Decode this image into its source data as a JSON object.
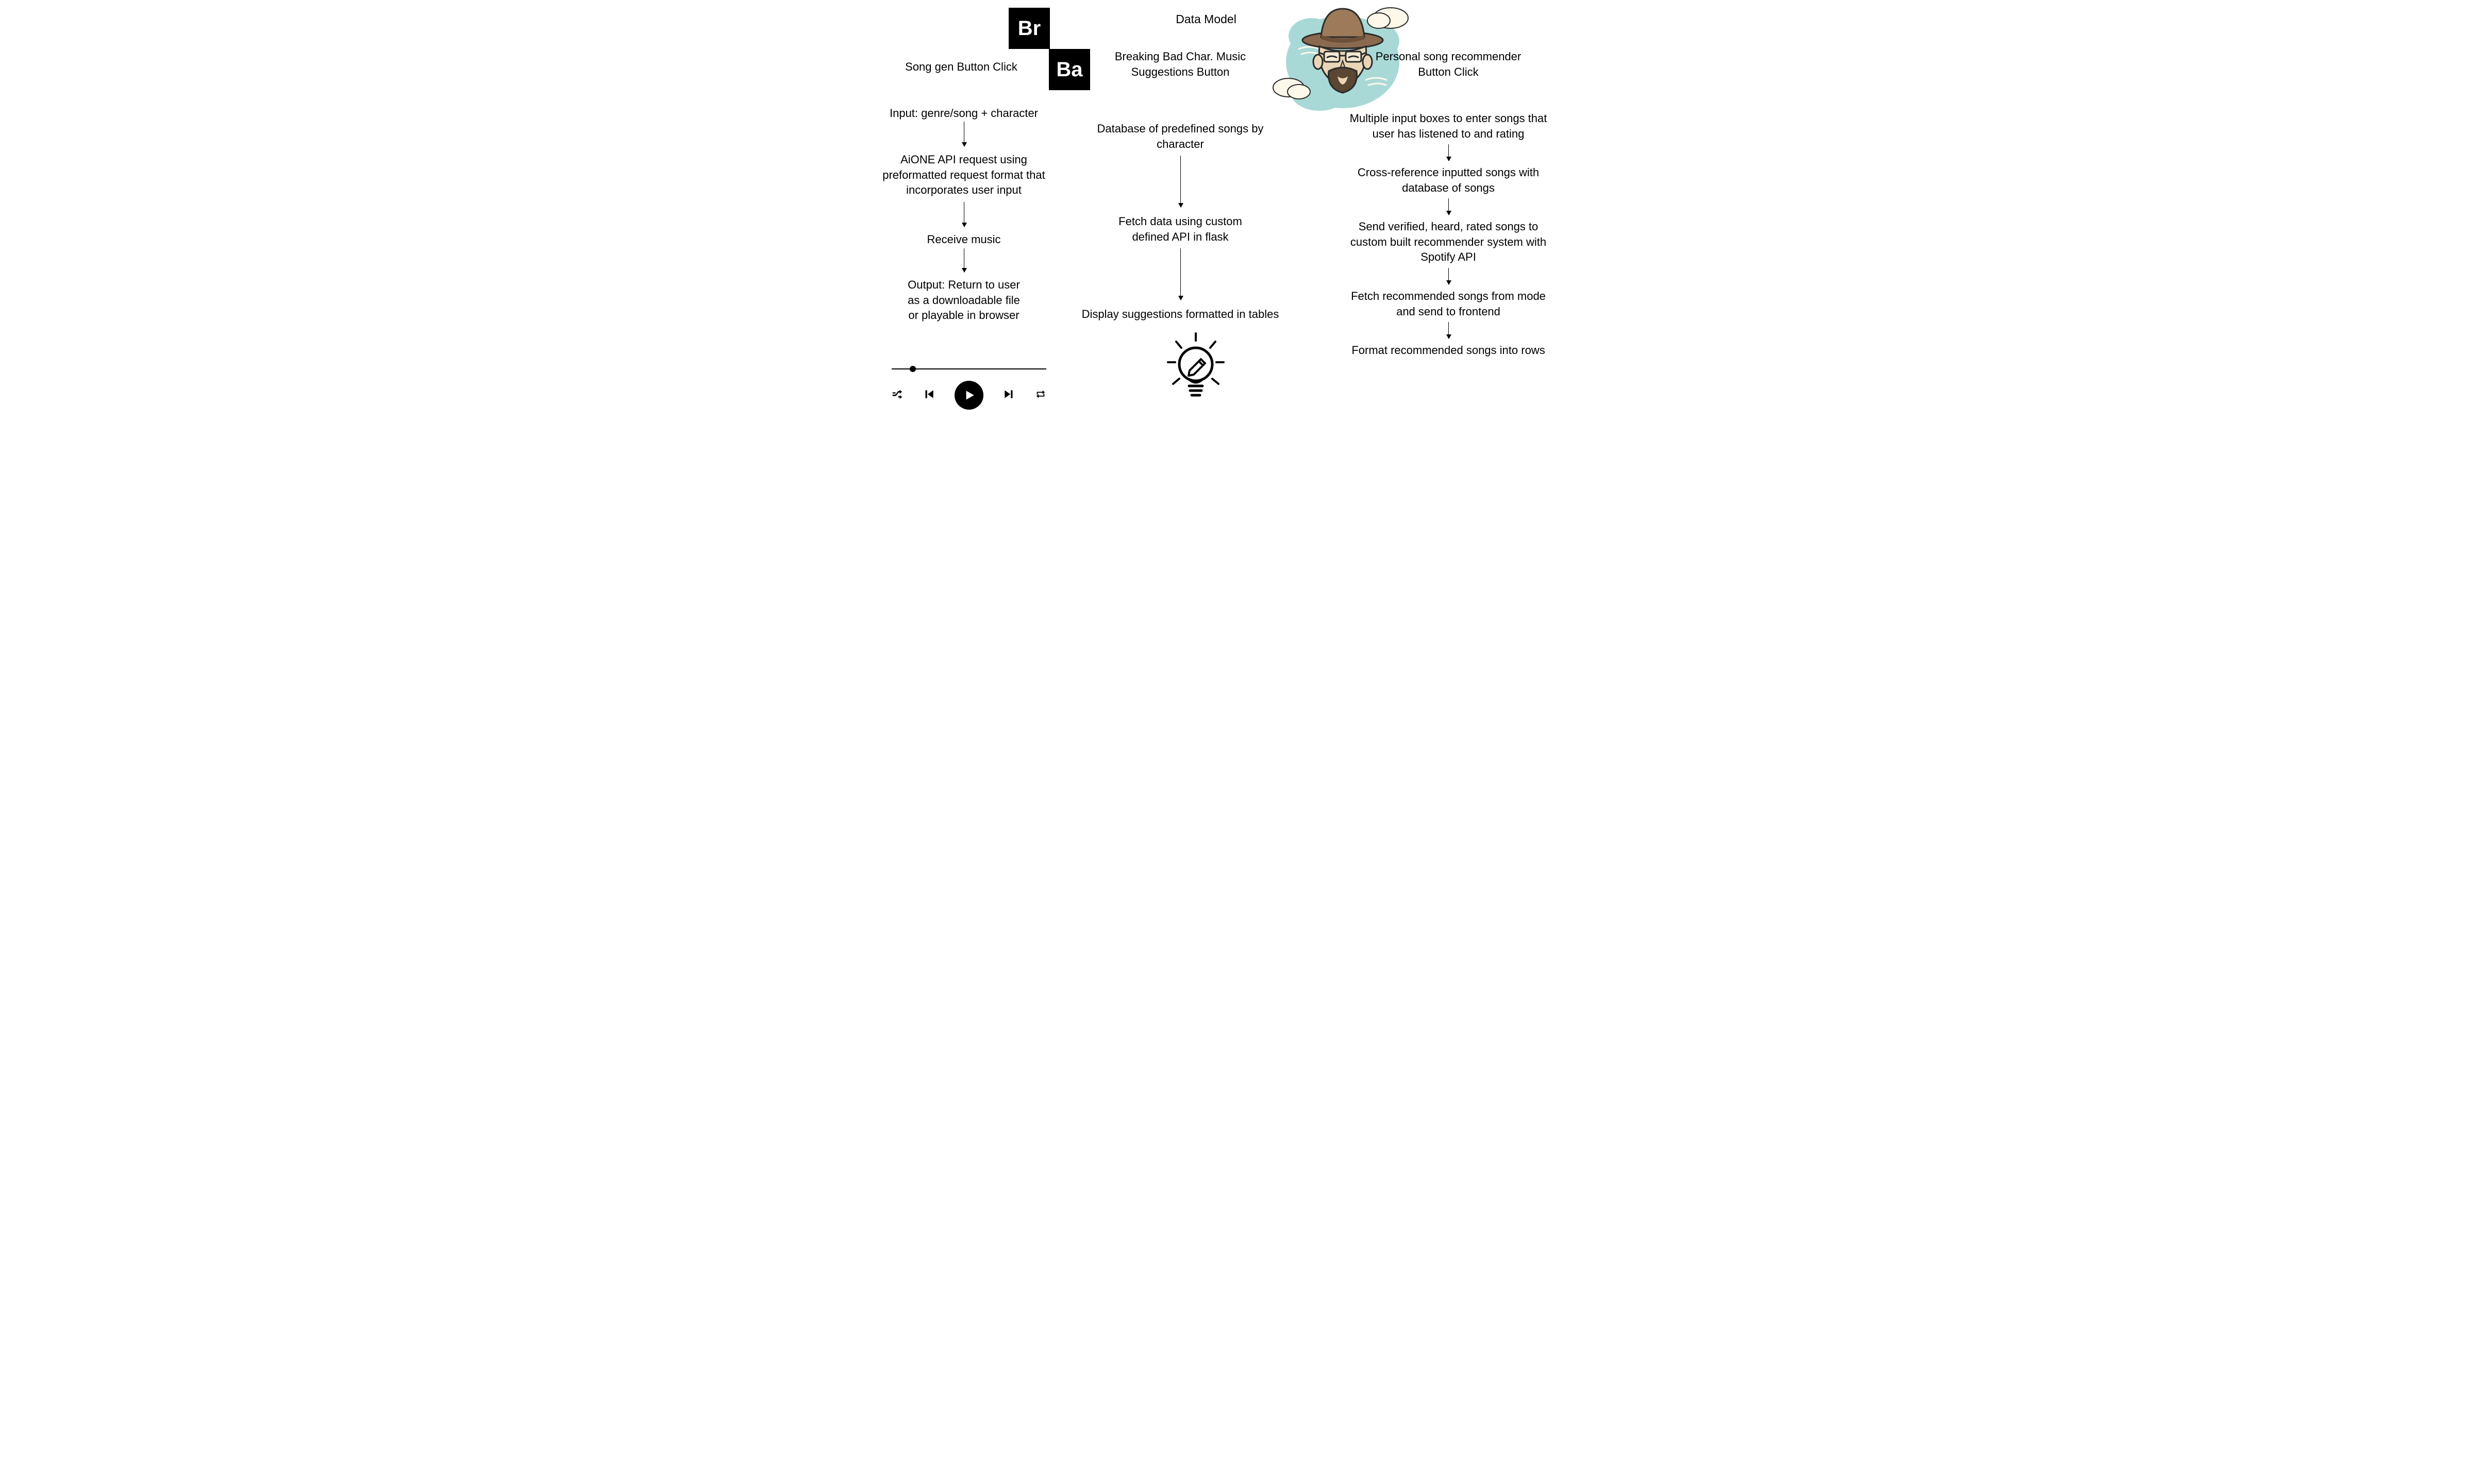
{
  "title": "Data Model",
  "logo": {
    "top": "Br",
    "bottom": "Ba"
  },
  "col1": {
    "heading": "Song gen Button Click",
    "steps": [
      "Input: genre/song + character",
      "AiONE API request using preformatted request format that incorporates user input",
      "Receive music",
      "Output: Return to user as a downloadable file or playable in browser"
    ]
  },
  "col2": {
    "heading": "Breaking Bad Char. Music Suggestions Button",
    "steps": [
      "Database of predefined songs by character",
      "Fetch data using custom defined API in flask",
      "Display suggestions formatted in tables"
    ]
  },
  "col3": {
    "heading": "Personal song recommender Button Click",
    "steps": [
      "Multiple input boxes to enter songs that user has listened to and rating",
      "Cross-reference inputted songs with database of songs",
      "Send verified, heard, rated songs to custom built recommender system with Spotify API",
      "Fetch recommended songs from mode and send to frontend",
      "Format recommended songs into rows"
    ]
  }
}
